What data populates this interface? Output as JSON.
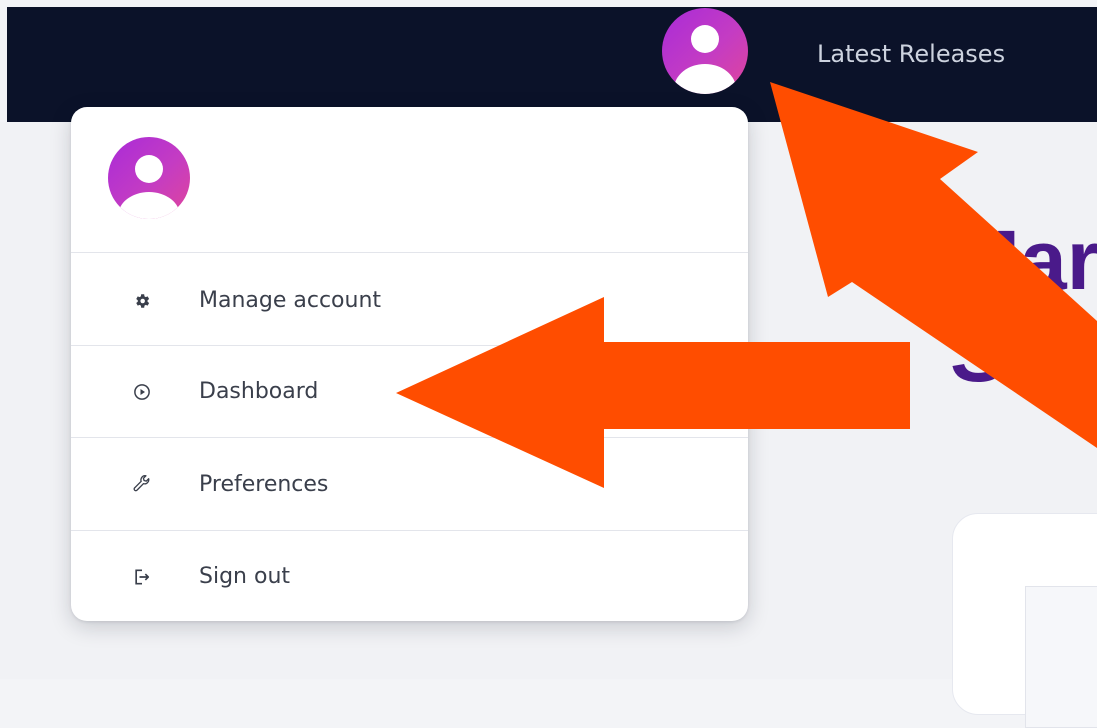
{
  "nav": {
    "latest_releases": "Latest Releases"
  },
  "hero": {
    "heading_line1": "Mar",
    "heading_line2": "St"
  },
  "menu": {
    "items": [
      {
        "label": "Manage account",
        "icon": "gear-icon"
      },
      {
        "label": "Dashboard",
        "icon": "play-circle-icon"
      },
      {
        "label": "Preferences",
        "icon": "wrench-icon"
      },
      {
        "label": "Sign out",
        "icon": "sign-out-icon"
      }
    ]
  },
  "colors": {
    "navbar": "#0b1229",
    "avatar_gradient": [
      "#a92bd8",
      "#e0459b"
    ],
    "annotation_arrow": "#ff4d00",
    "hero_heading": "#4a1a8a"
  }
}
